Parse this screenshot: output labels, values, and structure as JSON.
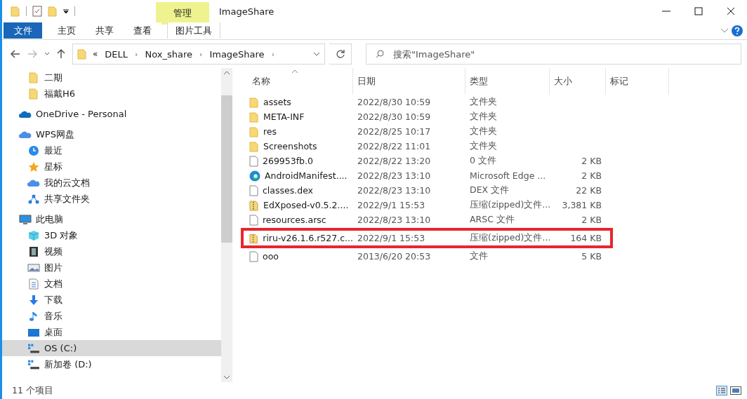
{
  "window": {
    "title": "ImageShare",
    "context_tab": "管理"
  },
  "ribbon": {
    "tabs": [
      {
        "label": "文件",
        "kind": "file",
        "selected": false
      },
      {
        "label": "主页",
        "kind": "plain",
        "selected": false
      },
      {
        "label": "共享",
        "kind": "plain",
        "selected": false
      },
      {
        "label": "查看",
        "kind": "plain",
        "selected": false
      },
      {
        "label": "图片工具",
        "kind": "context",
        "selected": false
      }
    ]
  },
  "address": {
    "overflow": "«",
    "path": [
      {
        "label": "DELL",
        "separator": "›"
      },
      {
        "label": "Nox_share",
        "separator": "›"
      },
      {
        "label": "ImageShare",
        "separator": "›"
      }
    ]
  },
  "search": {
    "placeholder": "搜索\"ImageShare\""
  },
  "sidebar": {
    "continued_items": [
      {
        "label": "二期",
        "kind": "folder",
        "selected": false
      },
      {
        "label": "福戴H6",
        "kind": "folder",
        "selected": false
      }
    ],
    "items": [
      {
        "label": "OneDrive - Personal",
        "kind": "cloud",
        "selected": false
      },
      {
        "label": "WPS网盘",
        "kind": "wps",
        "selected": false,
        "children": [
          {
            "label": "最近",
            "kind": "clock",
            "selected": false
          },
          {
            "label": "星标",
            "kind": "star",
            "selected": false
          },
          {
            "label": "我的云文档",
            "kind": "wps",
            "selected": false
          },
          {
            "label": "共享文件夹",
            "kind": "share",
            "selected": false
          }
        ]
      },
      {
        "label": "此电脑",
        "kind": "pc",
        "selected": false,
        "children": [
          {
            "label": "3D 对象",
            "kind": "cube",
            "selected": false
          },
          {
            "label": "视频",
            "kind": "film",
            "selected": false
          },
          {
            "label": "图片",
            "kind": "picture",
            "selected": false
          },
          {
            "label": "文档",
            "kind": "doc",
            "selected": false
          },
          {
            "label": "下载",
            "kind": "download",
            "selected": false
          },
          {
            "label": "音乐",
            "kind": "music",
            "selected": false
          },
          {
            "label": "桌面",
            "kind": "desktop",
            "selected": false
          },
          {
            "label": "OS (C:)",
            "kind": "drive",
            "selected": true
          },
          {
            "label": "新加卷 (D:)",
            "kind": "drive",
            "selected": false
          }
        ]
      }
    ]
  },
  "table": {
    "columns": [
      "名称",
      "日期",
      "类型",
      "大小",
      "标记"
    ],
    "rows": [
      {
        "kind": "folder",
        "name": "assets",
        "date": "2022/8/30 10:59",
        "type": "文件夹",
        "size": "",
        "highlighted": false
      },
      {
        "kind": "folder",
        "name": "META-INF",
        "date": "2022/8/30 10:59",
        "type": "文件夹",
        "size": "",
        "highlighted": false
      },
      {
        "kind": "folder",
        "name": "res",
        "date": "2022/8/25 10:17",
        "type": "文件夹",
        "size": "",
        "highlighted": false
      },
      {
        "kind": "folder",
        "name": "Screenshots",
        "date": "2022/8/22 11:01",
        "type": "文件夹",
        "size": "",
        "highlighted": false
      },
      {
        "kind": "file",
        "name": "269953fb.0",
        "date": "2022/8/22 13:20",
        "type": "0 文件",
        "size": "2 KB",
        "highlighted": false
      },
      {
        "kind": "edge",
        "name": "AndroidManifest....",
        "date": "2022/8/23 13:10",
        "type": "Microsoft Edge ...",
        "size": "2 KB",
        "highlighted": false
      },
      {
        "kind": "file",
        "name": "classes.dex",
        "date": "2022/8/23 13:10",
        "type": "DEX 文件",
        "size": "22 KB",
        "highlighted": false
      },
      {
        "kind": "zip",
        "name": "EdXposed-v0.5.2....",
        "date": "2022/9/1 15:53",
        "type": "压缩(zipped)文件...",
        "size": "3,381 KB",
        "highlighted": false
      },
      {
        "kind": "file",
        "name": "resources.arsc",
        "date": "2022/8/23 13:10",
        "type": "ARSC 文件",
        "size": "2 KB",
        "highlighted": false
      },
      {
        "kind": "zip",
        "name": "riru-v26.1.6.r527.c...",
        "date": "2022/9/1 15:53",
        "type": "压缩(zipped)文件...",
        "size": "164 KB",
        "highlighted": true
      },
      {
        "kind": "file",
        "name": "ooo",
        "date": "2013/6/20 20:53",
        "type": "文件",
        "size": "5 KB",
        "highlighted": false
      }
    ]
  },
  "status_bar": {
    "count": "11 个项目"
  }
}
